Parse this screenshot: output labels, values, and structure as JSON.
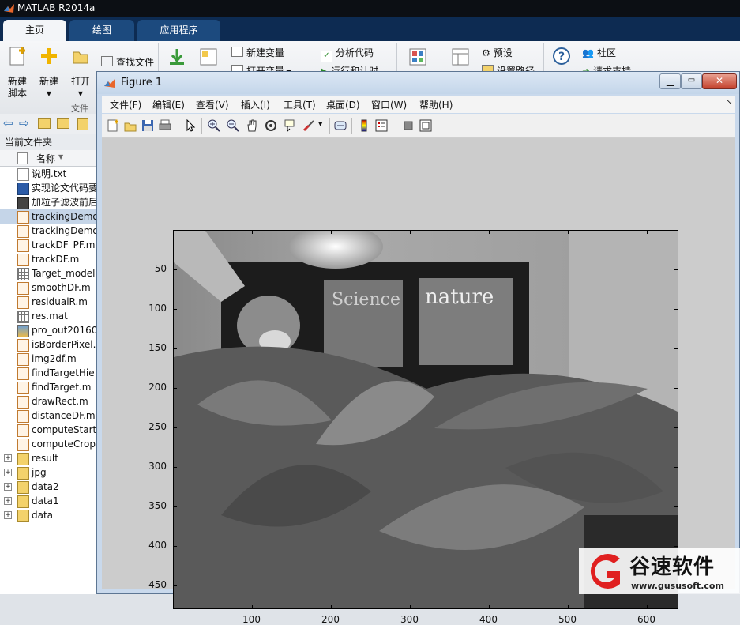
{
  "app": {
    "title": "MATLAB R2014a"
  },
  "tabs": [
    {
      "label": "主页",
      "active": true
    },
    {
      "label": "绘图",
      "active": false
    },
    {
      "label": "应用程序",
      "active": false
    }
  ],
  "ribbon": {
    "new_script": "新建\n脚本",
    "new": "新建",
    "open": "打开",
    "find_files": "查找文件",
    "section_file": "文件",
    "new_variable": "新建变量",
    "open_variable": "打开变量",
    "analyze_code": "分析代码",
    "run_and_time": "运行和计时",
    "preferences": "预设",
    "set_path": "设置路径",
    "community": "社区",
    "request_support": "请求支持"
  },
  "current_folder": {
    "title": "当前文件夹",
    "column_name": "名称",
    "files": [
      {
        "name": "说明.txt",
        "type": "txt"
      },
      {
        "name": "实现论文代码要",
        "type": "doc"
      },
      {
        "name": "加粒子滤波前后",
        "type": "media"
      },
      {
        "name": "trackingDemo",
        "type": "m",
        "selected": true
      },
      {
        "name": "trackingDemo",
        "type": "m"
      },
      {
        "name": "trackDF_PF.m",
        "type": "m"
      },
      {
        "name": "trackDF.m",
        "type": "m"
      },
      {
        "name": "Target_model",
        "type": "mat"
      },
      {
        "name": "smoothDF.m",
        "type": "m"
      },
      {
        "name": "residualR.m",
        "type": "m"
      },
      {
        "name": "res.mat",
        "type": "mat"
      },
      {
        "name": "pro_out20160",
        "type": "img"
      },
      {
        "name": "isBorderPixel.",
        "type": "m"
      },
      {
        "name": "img2df.m",
        "type": "m"
      },
      {
        "name": "findTargetHie",
        "type": "m"
      },
      {
        "name": "findTarget.m",
        "type": "m"
      },
      {
        "name": "drawRect.m",
        "type": "m"
      },
      {
        "name": "distanceDF.m",
        "type": "m"
      },
      {
        "name": "computeStarti",
        "type": "m"
      },
      {
        "name": "computeCrop",
        "type": "m"
      },
      {
        "name": "result",
        "type": "folder"
      },
      {
        "name": "jpg",
        "type": "folder"
      },
      {
        "name": "data2",
        "type": "folder"
      },
      {
        "name": "data1",
        "type": "folder"
      },
      {
        "name": "data",
        "type": "folder"
      }
    ]
  },
  "figure": {
    "title": "Figure 1",
    "menus": [
      "文件(F)",
      "编辑(E)",
      "查看(V)",
      "插入(I)",
      "工具(T)",
      "桌面(D)",
      "窗口(W)",
      "帮助(H)"
    ],
    "toolbar_icons": [
      "new-figure-icon",
      "open-icon",
      "save-icon",
      "print-icon",
      "pointer-icon",
      "zoom-in-icon",
      "zoom-out-icon",
      "pan-icon",
      "rotate-icon",
      "data-cursor-icon",
      "brush-icon",
      "link-icon",
      "colorbar-icon",
      "legend-icon",
      "hide-plot-tools-icon",
      "show-plot-tools-icon"
    ],
    "axes": {
      "y_ticks": [
        "50",
        "100",
        "150",
        "200",
        "250",
        "300",
        "350",
        "400",
        "450"
      ],
      "x_ticks": [
        "100",
        "200",
        "300",
        "400",
        "500",
        "600"
      ],
      "image_text": [
        "Science",
        "nature"
      ]
    }
  },
  "watermark": {
    "brand": "谷速软件",
    "url": "www.gususoft.com"
  }
}
